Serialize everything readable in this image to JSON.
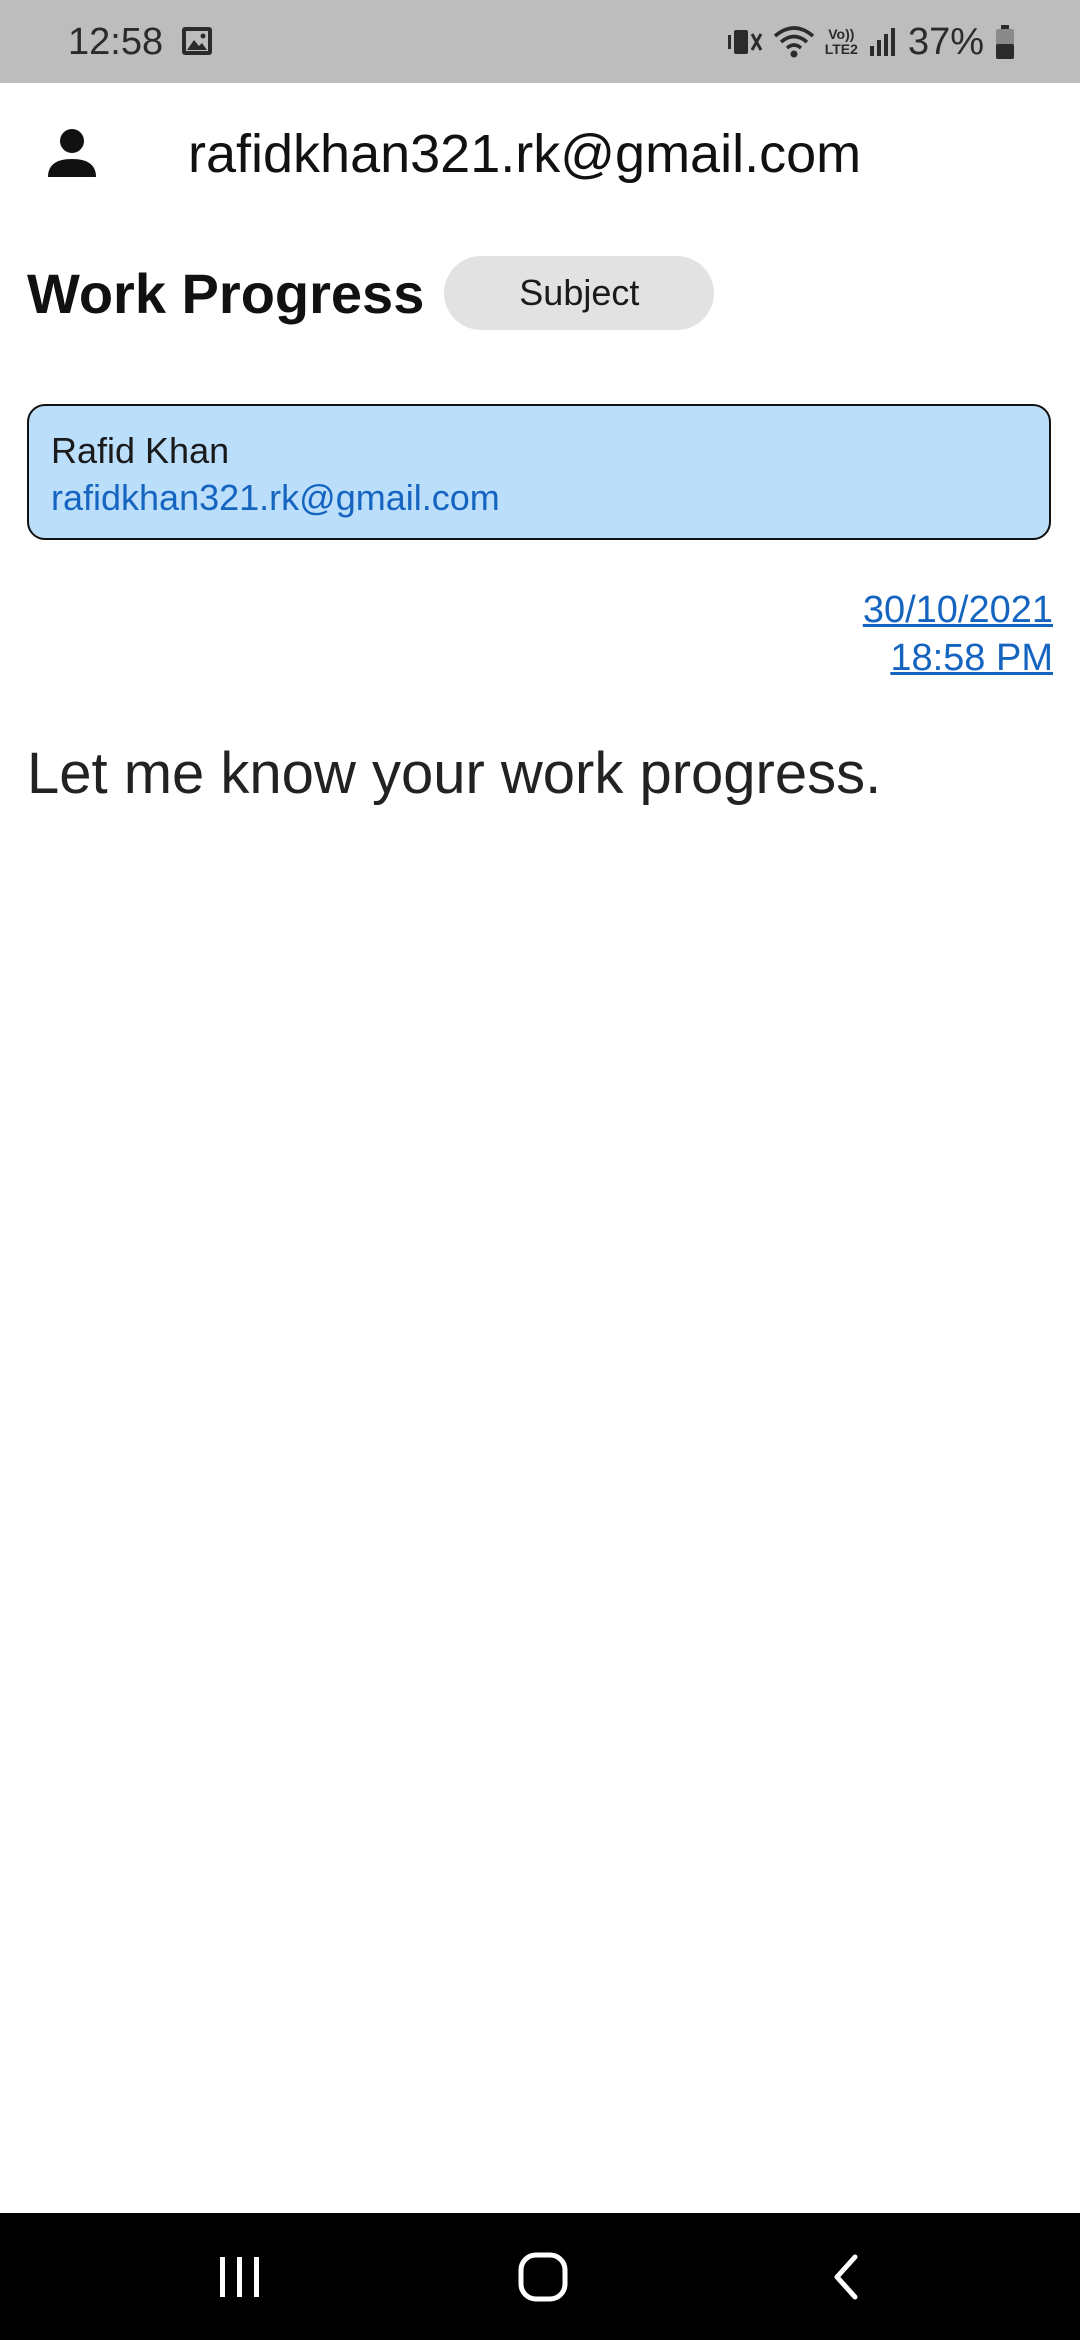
{
  "status_bar": {
    "time": "12:58",
    "gallery_icon": "image-icon",
    "mute_icon": "vibrate-off-icon",
    "wifi_icon": "wifi-icon",
    "volte_line1": "Vo))",
    "volte_line2": "LTE2",
    "signal_icon": "signal-icon",
    "battery_percent": "37%",
    "battery_icon": "battery-icon"
  },
  "account": {
    "icon": "person-icon",
    "email": "rafidkhan321.rk@gmail.com"
  },
  "header": {
    "title": "Work Progress",
    "subject_chip": "Subject"
  },
  "sender": {
    "name": "Rafid Khan",
    "email": "rafidkhan321.rk@gmail.com"
  },
  "timestamp": {
    "date": "30/10/2021",
    "time": "18:58 PM"
  },
  "message": {
    "body": "Let me know your work progress."
  },
  "nav_bar": {
    "recents_icon": "recents-icon",
    "home_icon": "home-icon",
    "back_icon": "back-icon"
  },
  "colors": {
    "status_bar_bg": "#bdbdbd",
    "card_bg": "#bbdefb",
    "link_blue": "#1565c0",
    "chip_bg": "#e2e2e2",
    "nav_bar_bg": "#000000"
  }
}
